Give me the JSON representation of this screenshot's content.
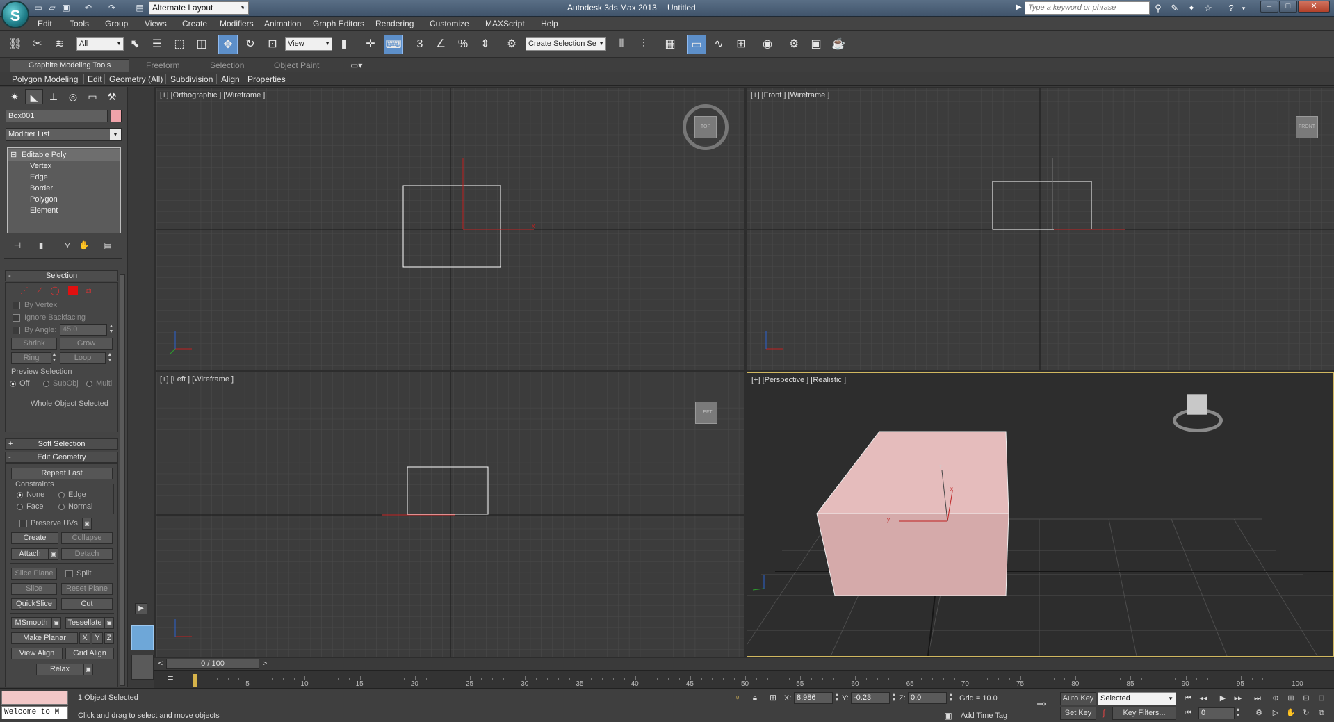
{
  "titlebar": {
    "app_title": "Autodesk 3ds Max 2013",
    "doc_title": "Untitled",
    "layout": "Alternate Layout",
    "search_placeholder": "Type a keyword or phrase",
    "logo_letter": "S"
  },
  "menus": [
    "Edit",
    "Tools",
    "Group",
    "Views",
    "Create",
    "Modifiers",
    "Animation",
    "Graph Editors",
    "Rendering",
    "Customize",
    "MAXScript",
    "Help"
  ],
  "toolbar": {
    "selection_filter": "All",
    "ref_coord": "View",
    "named_selection": "Create Selection Se"
  },
  "ribbon": {
    "tabs": [
      "Graphite Modeling Tools",
      "Freeform",
      "Selection",
      "Object Paint"
    ],
    "panels": [
      "Polygon Modeling",
      "Edit",
      "Geometry (All)",
      "Subdivision",
      "Align",
      "Properties"
    ]
  },
  "command_panel": {
    "object_name": "Box001",
    "object_color": "#f0a3aa",
    "modifier_list": "Modifier List",
    "stack": [
      "Editable Poly",
      "Vertex",
      "Edge",
      "Border",
      "Polygon",
      "Element"
    ],
    "selection": {
      "title": "Selection",
      "by_vertex": "By Vertex",
      "ignore_backfacing": "Ignore Backfacing",
      "by_angle": "By Angle:",
      "angle_value": "45.0",
      "shrink": "Shrink",
      "grow": "Grow",
      "ring": "Ring",
      "loop": "Loop",
      "preview_selection": "Preview Selection",
      "off": "Off",
      "subobj": "SubObj",
      "multi": "Multi",
      "status": "Whole Object Selected"
    },
    "soft_selection": "Soft Selection",
    "edit_geometry": {
      "title": "Edit Geometry",
      "repeat_last": "Repeat Last",
      "constraints": "Constraints",
      "none": "None",
      "edge": "Edge",
      "face": "Face",
      "normal": "Normal",
      "preserve_uvs": "Preserve UVs",
      "create": "Create",
      "collapse": "Collapse",
      "attach": "Attach",
      "detach": "Detach",
      "slice_plane": "Slice Plane",
      "split": "Split",
      "slice": "Slice",
      "reset_plane": "Reset Plane",
      "quickslice": "QuickSlice",
      "cut": "Cut",
      "msmooth": "MSmooth",
      "tessellate": "Tessellate",
      "make_planar": "Make Planar",
      "x": "X",
      "y": "Y",
      "z": "Z",
      "view_align": "View Align",
      "grid_align": "Grid Align",
      "relax": "Relax"
    }
  },
  "viewports": {
    "top_left": "[+] [Orthographic ] [Wireframe ]",
    "top_right": "[+] [Front ] [Wireframe ]",
    "bottom_left": "[+] [Left ] [Wireframe ]",
    "bottom_right": "[+] [Perspective ] [Realistic ]",
    "cube_top": "TOP",
    "cube_front": "FRONT",
    "cube_left": "LEFT",
    "axis_x": "x",
    "axis_y": "y",
    "axis_z": "z"
  },
  "timeline": {
    "frame": "0 / 100",
    "ticks": [
      "5",
      "10",
      "15",
      "20",
      "25",
      "30",
      "35",
      "40",
      "45",
      "50",
      "55",
      "60",
      "65",
      "70",
      "75",
      "80",
      "85",
      "90",
      "95",
      "100"
    ]
  },
  "status": {
    "objects_selected": "1 Object Selected",
    "prompt": "Click and drag to select and move objects",
    "maxscript": "Welcome to M",
    "x_label": "X:",
    "x_value": "8.986",
    "y_label": "Y:",
    "y_value": "-0.23",
    "z_label": "Z:",
    "z_value": "0.0",
    "grid": "Grid = 10.0",
    "add_time_tag": "Add Time Tag",
    "auto_key": "Auto Key",
    "set_key": "Set Key",
    "key_mode": "Selected",
    "key_filters": "Key Filters...",
    "current_frame": "0"
  },
  "colors": {
    "box_fill": "#e3b7b7",
    "viewport_active": "#d1b860",
    "selection_axis": "#c02020"
  }
}
